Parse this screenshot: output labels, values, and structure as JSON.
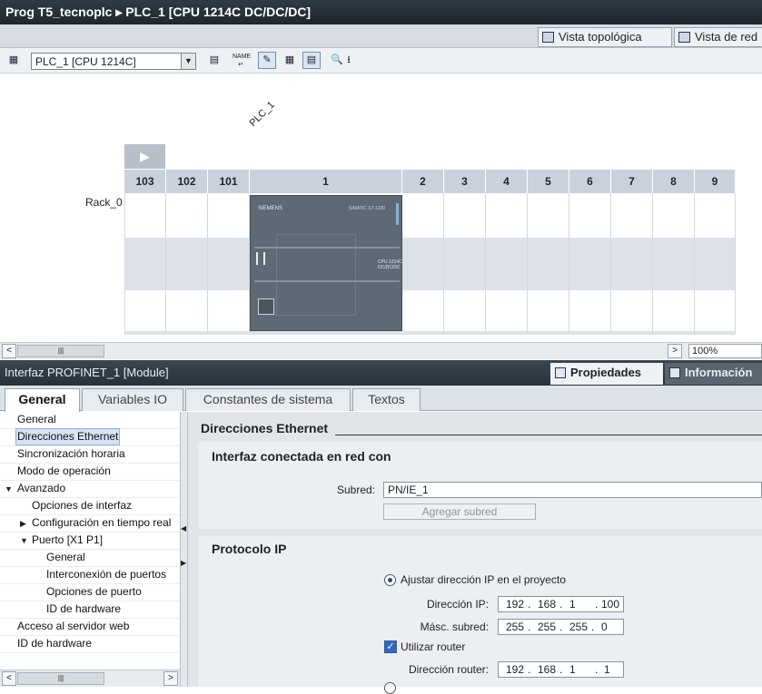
{
  "window": {
    "title": "Prog T5_tecnoplc  ▸  PLC_1 [CPU 1214C DC/DC/DC]"
  },
  "view_tabs": [
    "Vista topológica",
    "Vista de red"
  ],
  "toolbar": {
    "device_select": "PLC_1 [CPU 1214C]",
    "name_icon": "NAME"
  },
  "device_view": {
    "plc_name": "PLC_1",
    "rack_label": "Rack_0",
    "slots": [
      "103",
      "102",
      "101",
      "1",
      "2",
      "3",
      "4",
      "5",
      "6",
      "7",
      "8",
      "9"
    ],
    "cpu_brand": "SIEMENS",
    "cpu_model": "SIMATIC S7-1200",
    "cpu_type": "CPU 1214C DC/DC/DC"
  },
  "scrollbar": {
    "zoom": "100%"
  },
  "inspector": {
    "title": "Interfaz PROFINET_1 [Module]",
    "tabs": [
      "Propiedades",
      "Información"
    ],
    "subtabs": [
      "General",
      "Variables IO",
      "Constantes de sistema",
      "Textos"
    ],
    "tree": [
      {
        "label": "General",
        "indent": 0
      },
      {
        "label": "Direcciones Ethernet",
        "indent": 0,
        "selected": true
      },
      {
        "label": "Sincronización horaria",
        "indent": 0
      },
      {
        "label": "Modo de operación",
        "indent": 0
      },
      {
        "label": "Avanzado",
        "indent": 0,
        "expanded": true
      },
      {
        "label": "Opciones de interfaz",
        "indent": 1
      },
      {
        "label": "Configuración en tiempo real",
        "indent": 1,
        "collapsed": true
      },
      {
        "label": "Puerto [X1 P1]",
        "indent": 1,
        "expanded": true
      },
      {
        "label": "General",
        "indent": 2
      },
      {
        "label": "Interconexión de puertos",
        "indent": 2
      },
      {
        "label": "Opciones de puerto",
        "indent": 2
      },
      {
        "label": "ID de hardware",
        "indent": 2
      },
      {
        "label": "Acceso al servidor web",
        "indent": 0
      },
      {
        "label": "ID de hardware",
        "indent": 0
      }
    ],
    "section_title": "Direcciones Ethernet",
    "network": {
      "heading": "Interfaz conectada en red con",
      "subnet_label": "Subred:",
      "subnet_value": "PN/IE_1",
      "add_subnet_button": "Agregar subred"
    },
    "ip": {
      "heading": "Protocolo IP",
      "radio_project_label": "Ajustar dirección IP en el proyecto",
      "ip_label": "Dirección IP:",
      "ip": [
        "192",
        "168",
        "1",
        "100"
      ],
      "mask_label": "Másc. subred:",
      "mask": [
        "255",
        "255",
        "255",
        "0"
      ],
      "use_router_label": "Utilizar router",
      "router_label": "Dirección router:",
      "router": [
        "192",
        "168",
        "1",
        "1"
      ]
    }
  }
}
